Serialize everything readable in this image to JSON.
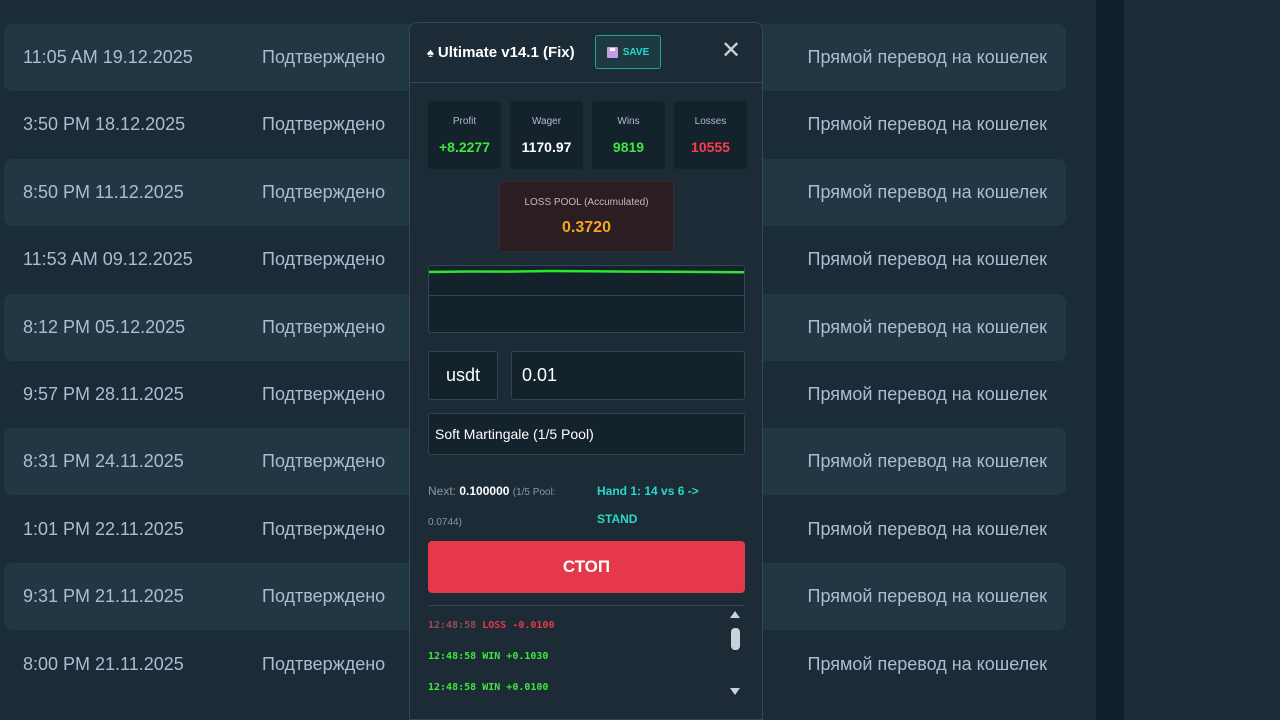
{
  "transactions": [
    {
      "date": "11:05 AM 19.12.2025",
      "status": "Подтверждено",
      "method": "Прямой перевод на кошелек"
    },
    {
      "date": "3:50 PM 18.12.2025",
      "status": "Подтверждено",
      "method": "Прямой перевод на кошелек"
    },
    {
      "date": "8:50 PM 11.12.2025",
      "status": "Подтверждено",
      "method": "Прямой перевод на кошелек"
    },
    {
      "date": "11:53 AM 09.12.2025",
      "status": "Подтверждено",
      "method": "Прямой перевод на кошелек"
    },
    {
      "date": "8:12 PM 05.12.2025",
      "status": "Подтверждено",
      "method": "Прямой перевод на кошелек"
    },
    {
      "date": "9:57 PM 28.11.2025",
      "status": "Подтверждено",
      "method": "Прямой перевод на кошелек"
    },
    {
      "date": "8:31 PM 24.11.2025",
      "status": "Подтверждено",
      "method": "Прямой перевод на кошелек"
    },
    {
      "date": "1:01 PM 22.11.2025",
      "status": "Подтверждено",
      "method": "Прямой перевод на кошелек"
    },
    {
      "date": "9:31 PM 21.11.2025",
      "status": "Подтверждено",
      "method": "Прямой перевод на кошелек"
    },
    {
      "date": "8:00 PM 21.11.2025",
      "status": "Подтверждено",
      "method": "Прямой перевод на кошелек"
    }
  ],
  "panel": {
    "title": "Ultimate v14.1 (Fix)",
    "save_label": "SAVE",
    "close_glyph": "✕",
    "stats": [
      {
        "label": "Profit",
        "value": "+8.2277",
        "color": "#3ee63e"
      },
      {
        "label": "Wager",
        "value": "1170.97",
        "color": "#ffffff"
      },
      {
        "label": "Wins",
        "value": "9819",
        "color": "#3ee63e"
      },
      {
        "label": "Losses",
        "value": "10555",
        "color": "#ff3b4e"
      }
    ],
    "loss_pool": {
      "label": "LOSS POOL (Accumulated)",
      "value": "0.3720"
    },
    "currency": "usdt",
    "amount": "0.01",
    "strategy": "Soft Martingale (1/5 Pool)",
    "next": {
      "label": "Next:",
      "value": "0.100000",
      "detail": "(1/5 Pool: 0.0744)"
    },
    "hand": "Hand 1: 14 vs 6 -> STAND",
    "stop_label": "СТОП",
    "log": [
      {
        "time": "12:48:58",
        "result": "LOSS",
        "amount": "-0.0100",
        "color": "#e5384a"
      },
      {
        "time": "12:48:58",
        "result": "WIN",
        "amount": "+0.1030",
        "color": "#3ee63e"
      },
      {
        "time": "12:48:58",
        "result": "WIN",
        "amount": "+0.0100",
        "color": "#3ee63e"
      }
    ],
    "accent_color": "#26d9c9",
    "stop_color": "#e5384a"
  }
}
